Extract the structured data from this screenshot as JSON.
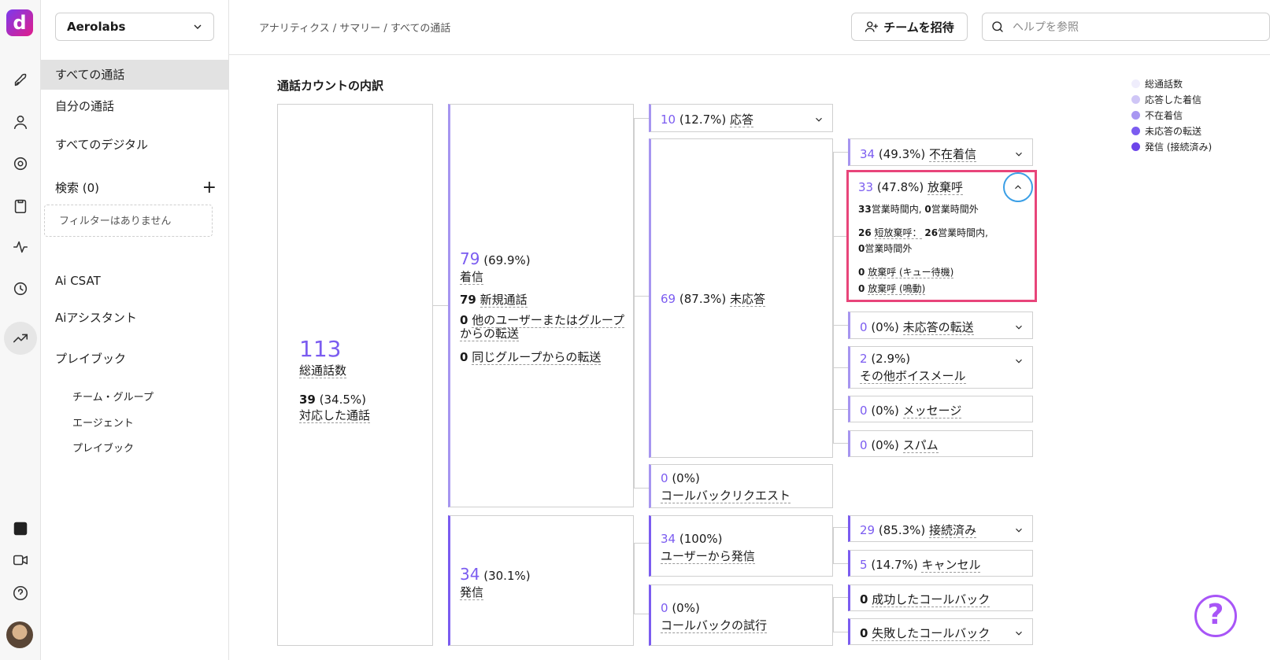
{
  "workspace": "Aerolabs",
  "sidebar": {
    "items": [
      "すべての通話",
      "自分の通話",
      "すべてのデジタル"
    ],
    "search_label": "検索 (0)",
    "no_filters": "フィルターはありません",
    "ai_csat": "Ai CSAT",
    "ai_assistant": "Aiアシスタント",
    "playbook": "プレイブック",
    "sub": [
      "チーム・グループ",
      "エージェント",
      "プレイブック"
    ]
  },
  "header": {
    "breadcrumb": "アナリティクス / サマリー / すべての通話",
    "invite": "チームを招待",
    "help_placeholder": "ヘルプを参照"
  },
  "title": "通話カウントの内訳",
  "legend": [
    {
      "label": "総通話数",
      "color": "#efedfc"
    },
    {
      "label": "応答した着信",
      "color": "#cfc6f6"
    },
    {
      "label": "不在着信",
      "color": "#a897f1"
    },
    {
      "label": "未応答の転送",
      "color": "#7b5cf0"
    },
    {
      "label": "発信 (接続済み)",
      "color": "#6d45ea"
    }
  ],
  "total": {
    "count": "113",
    "label": "総通話数",
    "handled_count": "39",
    "handled_pct": "(34.5%)",
    "handled_label": "対応した通話"
  },
  "incoming": {
    "count": "79",
    "pct": "(69.9%)",
    "label": "着信",
    "new_count": "79",
    "new_label": "新規通話",
    "xfer_other_count": "0",
    "xfer_other_label": "他のユーザーまたはグループからの転送",
    "xfer_same_count": "0",
    "xfer_same_label": "同じグループからの転送"
  },
  "answered": {
    "count": "10",
    "pct": "(12.7%)",
    "label": "応答"
  },
  "unanswered": {
    "count": "69",
    "pct": "(87.3%)",
    "label": "未応答"
  },
  "callback_req": {
    "count": "0",
    "pct": "(0%)",
    "label": "コールバックリクエスト"
  },
  "missed": {
    "count": "34",
    "pct": "(49.3%)",
    "label": "不在着信"
  },
  "abandoned": {
    "count": "33",
    "pct": "(47.8%)",
    "label": "放棄呼",
    "l1a": "33",
    "l1b": "営業時間内, ",
    "l1c": "0",
    "l1d": "営業時間外",
    "l2a": "26",
    "l2b": "短放棄呼：",
    "l2c": "26",
    "l2d": "営業時間内,",
    "l2e": "0",
    "l2f": "営業時間外",
    "l3a": "0",
    "l3b": "放棄呼 (キュー待機)",
    "l4a": "0",
    "l4b": "放棄呼 (鳴動)"
  },
  "unans_xfer": {
    "count": "0",
    "pct": "(0%)",
    "label": "未応答の転送"
  },
  "voicemail": {
    "count": "2",
    "pct": "(2.9%)",
    "label": "その他ボイスメール"
  },
  "message": {
    "count": "0",
    "pct": "(0%)",
    "label": "メッセージ"
  },
  "spam": {
    "count": "0",
    "pct": "(0%)",
    "label": "スパム"
  },
  "outgoing": {
    "count": "34",
    "pct": "(30.1%)",
    "label": "発信"
  },
  "user_out": {
    "count": "34",
    "pct": "(100%)",
    "label": "ユーザーから発信"
  },
  "callback_try": {
    "count": "0",
    "pct": "(0%)",
    "label": "コールバックの試行"
  },
  "connected": {
    "count": "29",
    "pct": "(85.3%)",
    "label": "接続済み"
  },
  "cancel": {
    "count": "5",
    "pct": "(14.7%)",
    "label": "キャンセル"
  },
  "cb_success": {
    "count": "0",
    "label": "成功したコールバック"
  },
  "cb_fail": {
    "count": "0",
    "label": "失敗したコールバック"
  }
}
